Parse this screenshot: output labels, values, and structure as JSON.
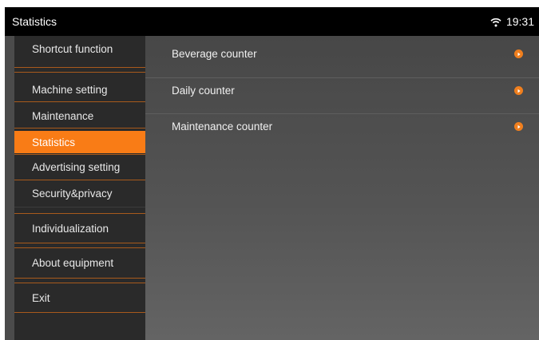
{
  "app": {
    "title": "Statistics",
    "time": "19:31"
  },
  "sidebar": {
    "items": [
      {
        "label": "Shortcut function"
      },
      {
        "label": "Machine setting"
      },
      {
        "label": "Maintenance"
      },
      {
        "label": "Statistics",
        "selected": true
      },
      {
        "label": "Advertising setting"
      },
      {
        "label": "Security&privacy"
      },
      {
        "label": "Individualization"
      },
      {
        "label": "About equipment"
      },
      {
        "label": "Exit"
      }
    ]
  },
  "main": {
    "rows": [
      {
        "label": "Beverage counter"
      },
      {
        "label": "Daily counter"
      },
      {
        "label": "Maintenance counter"
      }
    ]
  },
  "colors": {
    "accent": "#f97c16",
    "background": "#4b4b4b",
    "sidebar": "#2a2a2a",
    "topbar": "#000000"
  },
  "icons": [
    "wifi-icon",
    "chevron-right-icon"
  ]
}
